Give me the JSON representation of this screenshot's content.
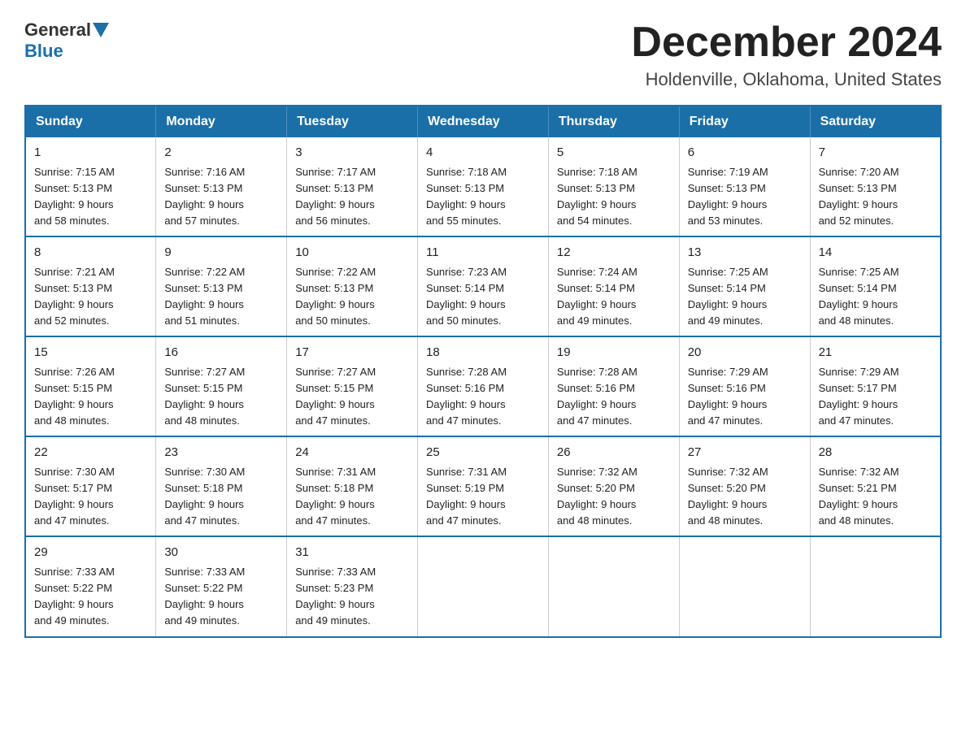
{
  "logo": {
    "text_before": "General",
    "text_after": "Blue"
  },
  "header": {
    "month_year": "December 2024",
    "location": "Holdenville, Oklahoma, United States"
  },
  "days_of_week": [
    "Sunday",
    "Monday",
    "Tuesday",
    "Wednesday",
    "Thursday",
    "Friday",
    "Saturday"
  ],
  "weeks": [
    [
      {
        "day": "1",
        "sunrise": "7:15 AM",
        "sunset": "5:13 PM",
        "daylight": "9 hours and 58 minutes."
      },
      {
        "day": "2",
        "sunrise": "7:16 AM",
        "sunset": "5:13 PM",
        "daylight": "9 hours and 57 minutes."
      },
      {
        "day": "3",
        "sunrise": "7:17 AM",
        "sunset": "5:13 PM",
        "daylight": "9 hours and 56 minutes."
      },
      {
        "day": "4",
        "sunrise": "7:18 AM",
        "sunset": "5:13 PM",
        "daylight": "9 hours and 55 minutes."
      },
      {
        "day": "5",
        "sunrise": "7:18 AM",
        "sunset": "5:13 PM",
        "daylight": "9 hours and 54 minutes."
      },
      {
        "day": "6",
        "sunrise": "7:19 AM",
        "sunset": "5:13 PM",
        "daylight": "9 hours and 53 minutes."
      },
      {
        "day": "7",
        "sunrise": "7:20 AM",
        "sunset": "5:13 PM",
        "daylight": "9 hours and 52 minutes."
      }
    ],
    [
      {
        "day": "8",
        "sunrise": "7:21 AM",
        "sunset": "5:13 PM",
        "daylight": "9 hours and 52 minutes."
      },
      {
        "day": "9",
        "sunrise": "7:22 AM",
        "sunset": "5:13 PM",
        "daylight": "9 hours and 51 minutes."
      },
      {
        "day": "10",
        "sunrise": "7:22 AM",
        "sunset": "5:13 PM",
        "daylight": "9 hours and 50 minutes."
      },
      {
        "day": "11",
        "sunrise": "7:23 AM",
        "sunset": "5:14 PM",
        "daylight": "9 hours and 50 minutes."
      },
      {
        "day": "12",
        "sunrise": "7:24 AM",
        "sunset": "5:14 PM",
        "daylight": "9 hours and 49 minutes."
      },
      {
        "day": "13",
        "sunrise": "7:25 AM",
        "sunset": "5:14 PM",
        "daylight": "9 hours and 49 minutes."
      },
      {
        "day": "14",
        "sunrise": "7:25 AM",
        "sunset": "5:14 PM",
        "daylight": "9 hours and 48 minutes."
      }
    ],
    [
      {
        "day": "15",
        "sunrise": "7:26 AM",
        "sunset": "5:15 PM",
        "daylight": "9 hours and 48 minutes."
      },
      {
        "day": "16",
        "sunrise": "7:27 AM",
        "sunset": "5:15 PM",
        "daylight": "9 hours and 48 minutes."
      },
      {
        "day": "17",
        "sunrise": "7:27 AM",
        "sunset": "5:15 PM",
        "daylight": "9 hours and 47 minutes."
      },
      {
        "day": "18",
        "sunrise": "7:28 AM",
        "sunset": "5:16 PM",
        "daylight": "9 hours and 47 minutes."
      },
      {
        "day": "19",
        "sunrise": "7:28 AM",
        "sunset": "5:16 PM",
        "daylight": "9 hours and 47 minutes."
      },
      {
        "day": "20",
        "sunrise": "7:29 AM",
        "sunset": "5:16 PM",
        "daylight": "9 hours and 47 minutes."
      },
      {
        "day": "21",
        "sunrise": "7:29 AM",
        "sunset": "5:17 PM",
        "daylight": "9 hours and 47 minutes."
      }
    ],
    [
      {
        "day": "22",
        "sunrise": "7:30 AM",
        "sunset": "5:17 PM",
        "daylight": "9 hours and 47 minutes."
      },
      {
        "day": "23",
        "sunrise": "7:30 AM",
        "sunset": "5:18 PM",
        "daylight": "9 hours and 47 minutes."
      },
      {
        "day": "24",
        "sunrise": "7:31 AM",
        "sunset": "5:18 PM",
        "daylight": "9 hours and 47 minutes."
      },
      {
        "day": "25",
        "sunrise": "7:31 AM",
        "sunset": "5:19 PM",
        "daylight": "9 hours and 47 minutes."
      },
      {
        "day": "26",
        "sunrise": "7:32 AM",
        "sunset": "5:20 PM",
        "daylight": "9 hours and 48 minutes."
      },
      {
        "day": "27",
        "sunrise": "7:32 AM",
        "sunset": "5:20 PM",
        "daylight": "9 hours and 48 minutes."
      },
      {
        "day": "28",
        "sunrise": "7:32 AM",
        "sunset": "5:21 PM",
        "daylight": "9 hours and 48 minutes."
      }
    ],
    [
      {
        "day": "29",
        "sunrise": "7:33 AM",
        "sunset": "5:22 PM",
        "daylight": "9 hours and 49 minutes."
      },
      {
        "day": "30",
        "sunrise": "7:33 AM",
        "sunset": "5:22 PM",
        "daylight": "9 hours and 49 minutes."
      },
      {
        "day": "31",
        "sunrise": "7:33 AM",
        "sunset": "5:23 PM",
        "daylight": "9 hours and 49 minutes."
      },
      null,
      null,
      null,
      null
    ]
  ],
  "labels": {
    "sunrise": "Sunrise:",
    "sunset": "Sunset:",
    "daylight": "Daylight:"
  }
}
